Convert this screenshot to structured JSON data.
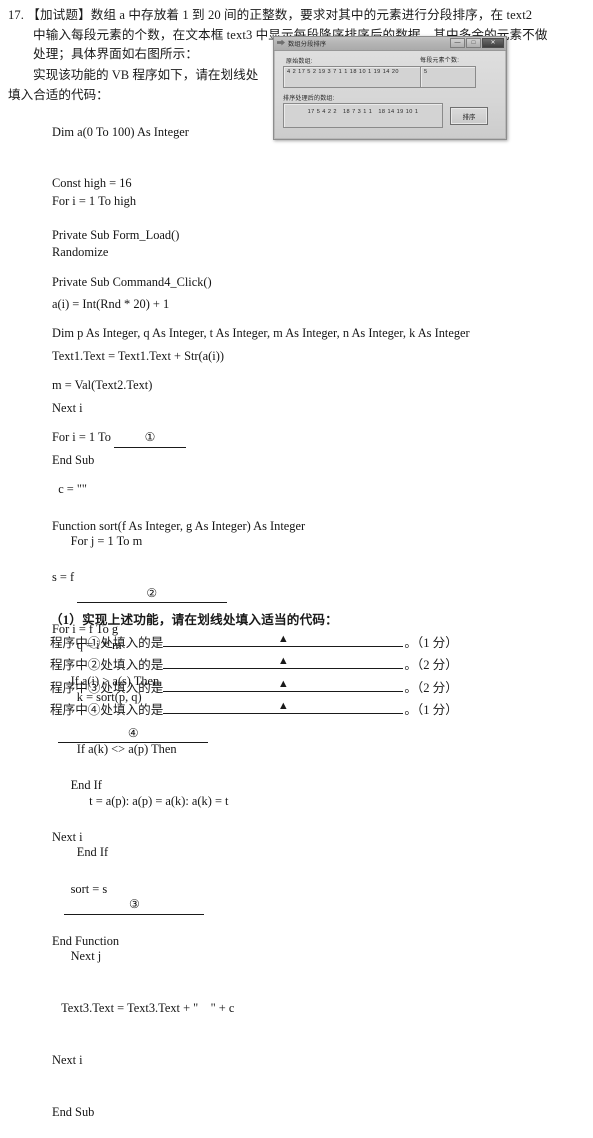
{
  "question": {
    "number": "17.",
    "tag": "【加试题】",
    "stem_line1": "数组 a 中存放着 1 到 20 间的正整数，要求对其中的元素进行分段排序，在 text2",
    "stem_line2": "中输入每段元素的个数，在文本框 text3 中显示每段降序排序后的数据，其中多余的元素不做",
    "stem_line3": "处理；具体界面如右图所示：",
    "stem_line4": "实现该功能的 VB 程序如下，请在划线处",
    "stem_line5": "填入合适的代码："
  },
  "code": {
    "block_a": [
      "Dim a(0 To 100) As Integer",
      "Const high = 16",
      "Private Sub Form_Load()"
    ],
    "block_b": [
      "For i = 1 To high",
      "Randomize",
      "a(i) = Int(Rnd * 20) + 1",
      "Text1.Text = Text1.Text + Str(a(i))",
      "Next i",
      "End Sub"
    ],
    "block_c": {
      "l1": "Private Sub Command4_Click()",
      "l2": "Dim p As Integer, q As Integer, t As Integer, m As Integer, n As Integer, k As Integer",
      "l3": "m = Val(Text2.Text)",
      "l4_pre": "For i = 1 To ",
      "blank1": "①",
      "l5": "  c = \"\"",
      "l6": "      For j = 1 To m",
      "blank2": "②",
      "l8": "        q = i * m",
      "l9": "        k = sort(p, q)",
      "l10": "        If a(k) <> a(p) Then",
      "l11": "            t = a(p): a(p) = a(k): a(k) = t",
      "l12": "        End If",
      "blank3": "③",
      "l14": "      Next j",
      "l15": "   Text3.Text = Text3.Text + \"    \" + c",
      "l16": "Next i",
      "l17": "End Sub"
    },
    "block_d": {
      "l1": "Function sort(f As Integer, g As Integer) As Integer",
      "l2": "s = f",
      "l3": "For i = f To g",
      "l4": "      If a(i) > a(s) Then",
      "blank4": "④",
      "l6": "      End If",
      "l7": "Next i",
      "l8": "      sort = s",
      "l9": "End Function"
    }
  },
  "sub_questions": {
    "lead": "（1）实现上述功能，请在划线处填入适当的代码：",
    "rows": [
      {
        "label": "程序中①处填入的是",
        "mark": "▲",
        "tail": "。（1 分）"
      },
      {
        "label": "程序中②处填入的是",
        "mark": "▲",
        "tail": "。（2 分）"
      },
      {
        "label": "程序中③处填入的是",
        "mark": "▲",
        "tail": "。（2 分）"
      },
      {
        "label": "程序中④处填入的是",
        "mark": "▲",
        "tail": "。（1 分）"
      }
    ]
  },
  "dialog": {
    "title": "数组分段排序",
    "window_buttons": {
      "minimize": "—",
      "maximize": "□",
      "close": "✕"
    },
    "labels": {
      "original": "原始数组:",
      "segment_count": "每段元素个数:",
      "sorted": "排序处理后的数组:"
    },
    "fields": {
      "text1_value": "4 2 17 5 2 19 3 7 1 1 18 10 1 19 14 20",
      "text2_value": "5",
      "text3_value": "17 5 4 2 2   18 7 3 1 1   18 14 19 10 1"
    },
    "sort_button": "排序"
  }
}
